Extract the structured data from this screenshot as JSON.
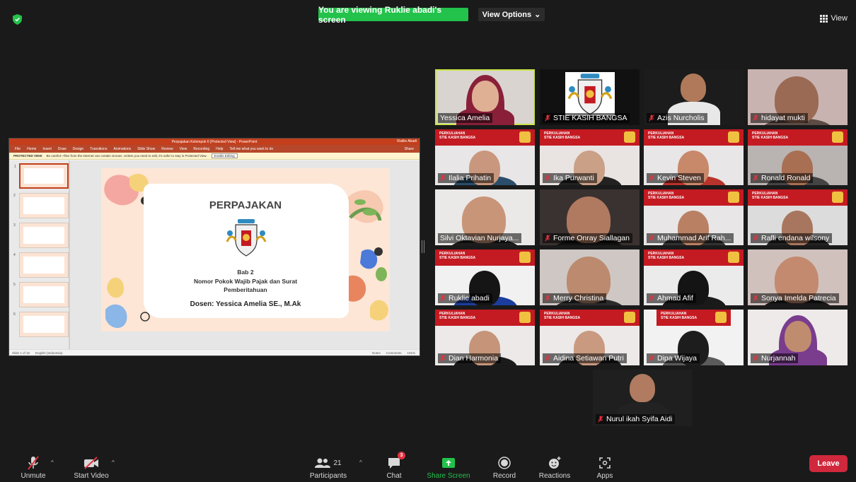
{
  "top": {
    "share_banner": "You are viewing Ruklie abadi's screen",
    "view_options": "View Options",
    "view_options_caret": "⌄",
    "view_label": "View"
  },
  "shared_screen": {
    "window_title": "Perpajakan Kelompok 6 [Protected View] - PowerPoint",
    "window_user": "Ruklie Abadi",
    "ribbon_tabs": [
      "File",
      "Home",
      "Insert",
      "Draw",
      "Design",
      "Transitions",
      "Animations",
      "Slide Show",
      "Review",
      "View",
      "Recording",
      "Help"
    ],
    "tell_me": "Tell me what you want to do",
    "share_label": "Share",
    "protected_label": "PROTECTED VIEW",
    "protected_text": "Be careful—files from the Internet can contain viruses. Unless you need to edit, it's safer to stay in Protected View.",
    "enable_editing": "Enable Editing",
    "thumb_numbers": [
      "1",
      "2",
      "3",
      "4",
      "5",
      "6"
    ],
    "slide": {
      "title": "PERPAJAKAN",
      "bab": "Bab 2",
      "subtitle_1": "Nomor Pokok Wajib Pajak dan Surat",
      "subtitle_2": "Pemberitahuan",
      "dosen": "Dosen: Yessica Amelia SE., M.Ak"
    },
    "status_left": "Slide 1 of 15",
    "status_lang": "English (Indonesia)",
    "status_notes": "Notes",
    "status_comments": "Comments",
    "status_zoom": "101%"
  },
  "participants": [
    {
      "name": "Yessica Amelia",
      "muted": false,
      "speaking": true,
      "bg": "#d9d4cf",
      "skin": "#e0b094",
      "cloth": "#8a1f3a",
      "type": "hijab"
    },
    {
      "name": "STIE KASIH BANGSA",
      "muted": true,
      "speaking": false,
      "bg": "#111111",
      "type": "logo"
    },
    {
      "name": "Azis Nurcholis",
      "muted": true,
      "speaking": false,
      "bg": "#1c1c1c",
      "skin": "#b07a5a",
      "cloth": "#e8e8e8",
      "type": "small"
    },
    {
      "name": "hidayat mukti",
      "muted": true,
      "speaking": false,
      "bg": "#c9b3b0",
      "skin": "#9b6a54",
      "cloth": "#5d4b46",
      "type": "close"
    },
    {
      "name": "Ilalia Prihatin",
      "muted": true,
      "speaking": false,
      "bg": "#e8e6e6",
      "skin": "#c9977d",
      "cloth": "#2a4e6b",
      "type": "banner"
    },
    {
      "name": "Ika Purwanti",
      "muted": true,
      "speaking": false,
      "bg": "#e9e4e2",
      "skin": "#caa086",
      "cloth": "#222222",
      "type": "banner"
    },
    {
      "name": "Kevin Steven",
      "muted": true,
      "speaking": false,
      "bg": "#e8e6e6",
      "skin": "#c8886a",
      "cloth": "#b8332b",
      "type": "banner"
    },
    {
      "name": "Ronald Ronald",
      "muted": true,
      "speaking": false,
      "bg": "#b9b3b2",
      "skin": "#a86f52",
      "cloth": "#444444",
      "type": "banner"
    },
    {
      "name": "Silvi Oktavian Nurjaya...",
      "muted": false,
      "speaking": false,
      "bg": "#ebe9e7",
      "skin": "#c99579",
      "cloth": "#1d1d1d",
      "type": "close"
    },
    {
      "name": "Forme Onray Siallagan",
      "muted": true,
      "speaking": false,
      "bg": "#3a3230",
      "skin": "#b07a60",
      "cloth": "#101010",
      "type": "close"
    },
    {
      "name": "Muhammad Arif Rah...",
      "muted": true,
      "speaking": false,
      "bg": "#e8e6e6",
      "skin": "#b98064",
      "cloth": "#333333",
      "type": "banner"
    },
    {
      "name": "Rafli endana wilsony",
      "muted": true,
      "speaking": false,
      "bg": "#dcdcdc",
      "skin": "#a8765e",
      "cloth": "#232323",
      "type": "banner"
    },
    {
      "name": "Ruklie abadi",
      "muted": true,
      "speaking": false,
      "bg": "#f1f1f1",
      "skin": "#151515",
      "cloth": "#1b3e9e",
      "type": "banner"
    },
    {
      "name": "Merry Christina",
      "muted": true,
      "speaking": false,
      "bg": "#cfc7c4",
      "skin": "#bc8a6e",
      "cloth": "#2b2b2b",
      "type": "close"
    },
    {
      "name": "Ahmad Afif",
      "muted": true,
      "speaking": false,
      "bg": "#ebebeb",
      "skin": "#141414",
      "cloth": "#1a1a1a",
      "type": "banner"
    },
    {
      "name": "Sonya Imelda Patrecia",
      "muted": true,
      "speaking": false,
      "bg": "#d1c1bd",
      "skin": "#c38a6f",
      "cloth": "#1a1a1a",
      "type": "close"
    },
    {
      "name": "Dian Harmonia",
      "muted": true,
      "speaking": false,
      "bg": "#ece9e8",
      "skin": "#c69479",
      "cloth": "#1b1b1b",
      "type": "banner"
    },
    {
      "name": "Aidina Setiawan Putri",
      "muted": true,
      "speaking": false,
      "bg": "#ece9e8",
      "skin": "#c99a80",
      "cloth": "#1b1b1b",
      "type": "banner"
    },
    {
      "name": "Dipa Wijaya",
      "muted": true,
      "speaking": false,
      "bg": "#f2f2f2",
      "skin": "#1d1d1d",
      "cloth": "#5b5b5b",
      "type": "banner2"
    },
    {
      "name": "Nurjannah",
      "muted": true,
      "speaking": false,
      "bg": "#eeeaea",
      "skin": "#c08c70",
      "cloth": "#7a3d8e",
      "type": "hijab2"
    },
    {
      "name": "Nurul ikah Syifa Aidi",
      "muted": true,
      "speaking": false,
      "bg": "#1f1f1f",
      "skin": "#b07b60",
      "cloth": "#222222",
      "type": "small"
    }
  ],
  "banner_text_1": "PERKULIAHAN",
  "banner_text_2": "STIE KASIH BANGSA",
  "toolbar": {
    "unmute": "Unmute",
    "start_video": "Start Video",
    "participants": "Participants",
    "participants_count": "21",
    "chat": "Chat",
    "chat_badge": "3",
    "share_screen": "Share Screen",
    "record": "Record",
    "reactions": "Reactions",
    "apps": "Apps",
    "leave": "Leave",
    "caret": "^"
  },
  "colors": {
    "background": "#1a1a1a",
    "zoom_green": "#22c24b",
    "leave_red": "#d0283c",
    "speaker_outline": "#c8e64a",
    "banner_red": "#c41a22",
    "ppt_orange": "#c43e1c"
  }
}
